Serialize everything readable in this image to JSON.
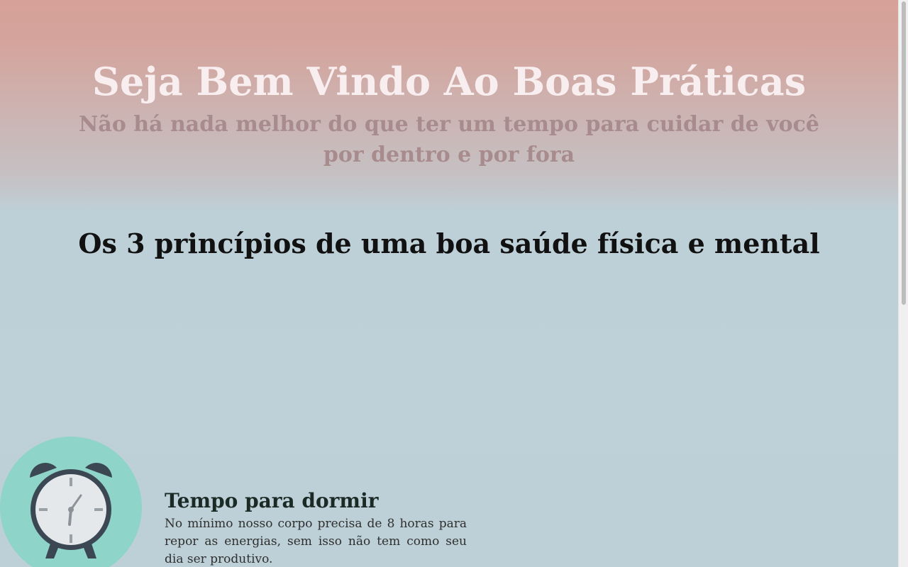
{
  "header": {
    "title": "Seja Bem Vindo Ao Boas Práticas",
    "subtitle": "Não há nada melhor do que ter um tempo para cuidar de você por dentro e por fora"
  },
  "section": {
    "title": "Os 3 princípios de uma boa saúde física e mental"
  },
  "features": [
    {
      "icon": "alarm-clock-icon",
      "heading": "Tempo para dormir",
      "text": "No mínimo nosso corpo precisa de 8 horas para repor as energias, sem isso não tem como seu dia ser produtivo."
    }
  ],
  "colors": {
    "title": "#f8eeef",
    "subtitle": "#a88b8d",
    "icon_circle": "#8fd4c9",
    "clock_dark": "#3b4753"
  }
}
